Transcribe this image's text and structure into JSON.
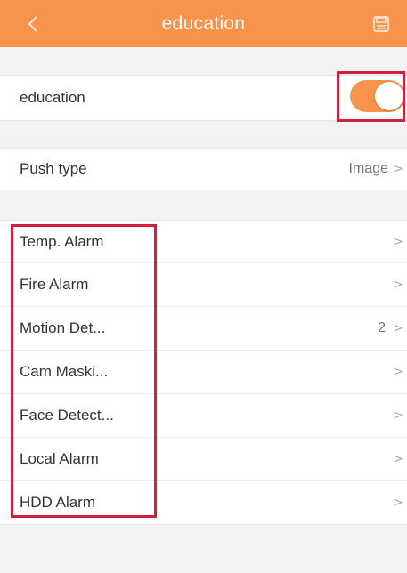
{
  "header": {
    "title": "education",
    "back_icon": "chevron-left-icon",
    "save_icon": "save-icon",
    "bg_color": "#f7934a"
  },
  "toggle_row": {
    "label": "education",
    "enabled": true,
    "accent_color": "#f7934a"
  },
  "push_type": {
    "label": "Push type",
    "value": "Image"
  },
  "alarms": [
    {
      "label": "Temp. Alarm",
      "count": ""
    },
    {
      "label": "Fire Alarm",
      "count": ""
    },
    {
      "label": "Motion Det...",
      "count": "2"
    },
    {
      "label": "Cam Maski...",
      "count": ""
    },
    {
      "label": "Face Detect...",
      "count": ""
    },
    {
      "label": "Local Alarm",
      "count": ""
    },
    {
      "label": "HDD Alarm",
      "count": ""
    }
  ],
  "chevron_glyph": ">",
  "highlight_color": "#d3203a"
}
